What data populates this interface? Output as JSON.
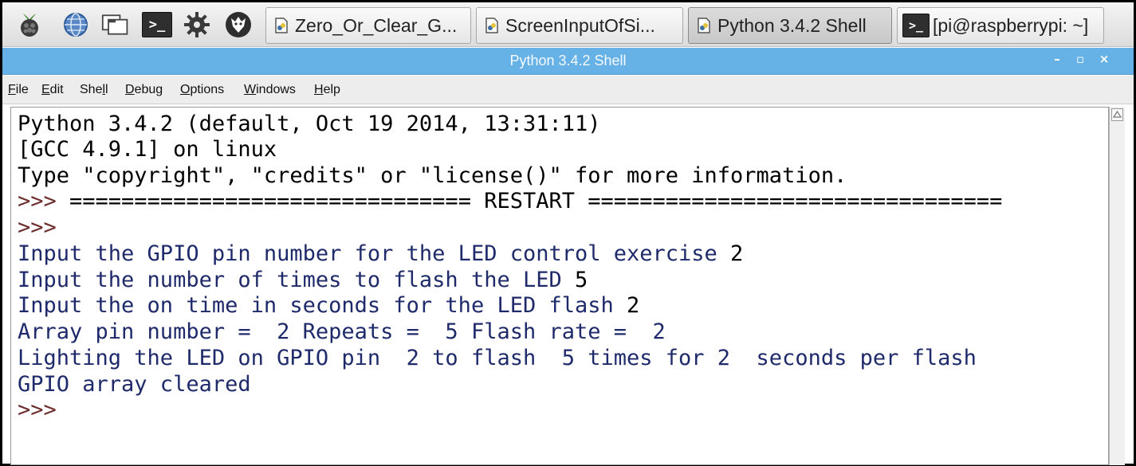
{
  "taskbar": {
    "launchers": [
      "raspberry-menu-icon",
      "web-browser-icon",
      "file-manager-icon",
      "terminal-icon",
      "settings-gear-icon",
      "wolfram-icon"
    ],
    "tasks": [
      {
        "label": "Zero_Or_Clear_G...",
        "icon": "python-file-icon"
      },
      {
        "label": "ScreenInputOfSi...",
        "icon": "python-file-icon"
      },
      {
        "label": "Python 3.4.2 Shell",
        "icon": "python-file-icon",
        "active": true
      },
      {
        "label": "[pi@raspberrypi: ~]",
        "icon": "terminal-icon"
      }
    ],
    "terminal_glyph": ">_"
  },
  "window": {
    "title": "Python 3.4.2 Shell",
    "controls": {
      "minimize": "–",
      "maximize": "▫",
      "close": "×"
    }
  },
  "menu": [
    {
      "label": "File",
      "mnemonic": "F"
    },
    {
      "label": "Edit",
      "mnemonic": "E"
    },
    {
      "label": "Shell",
      "mnemonic": "l"
    },
    {
      "label": "Debug",
      "mnemonic": "D"
    },
    {
      "label": "Options",
      "mnemonic": "O"
    },
    {
      "label": "Windows",
      "mnemonic": "W"
    },
    {
      "label": "Help",
      "mnemonic": "H"
    }
  ],
  "shell": {
    "lines": [
      {
        "text": "Python 3.4.2 (default, Oct 19 2014, 13:31:11)",
        "kind": "out"
      },
      {
        "text": "[GCC 4.9.1] on linux",
        "kind": "out"
      },
      {
        "text": "Type \"copyright\", \"credits\" or \"license()\" for more information.",
        "kind": "out"
      },
      {
        "text": ">>> ",
        "kind": "prompt",
        "rest": "=============================== RESTART ================================"
      },
      {
        "text": ">>> ",
        "kind": "prompt"
      },
      {
        "text": "Input the GPIO pin number for the LED control exercise ",
        "kind": "stdout",
        "input": "2"
      },
      {
        "text": "Input the number of times to flash the LED ",
        "kind": "stdout",
        "input": "5"
      },
      {
        "text": "Input the on time in seconds for the LED flash ",
        "kind": "stdout",
        "input": "2"
      },
      {
        "text": "Array pin number =  2 Repeats =  5 Flash rate =  2",
        "kind": "stdout"
      },
      {
        "text": "Lighting the LED on GPIO pin  2 to flash  5 times for 2  seconds per flash",
        "kind": "stdout"
      },
      {
        "text": "GPIO array cleared",
        "kind": "stdout"
      },
      {
        "text": ">>> ",
        "kind": "prompt"
      }
    ]
  },
  "colors": {
    "titlebar": "#66b1e6",
    "prompt": "#6d2d2d",
    "stdout": "#1f2a6b",
    "output": "#000000"
  }
}
